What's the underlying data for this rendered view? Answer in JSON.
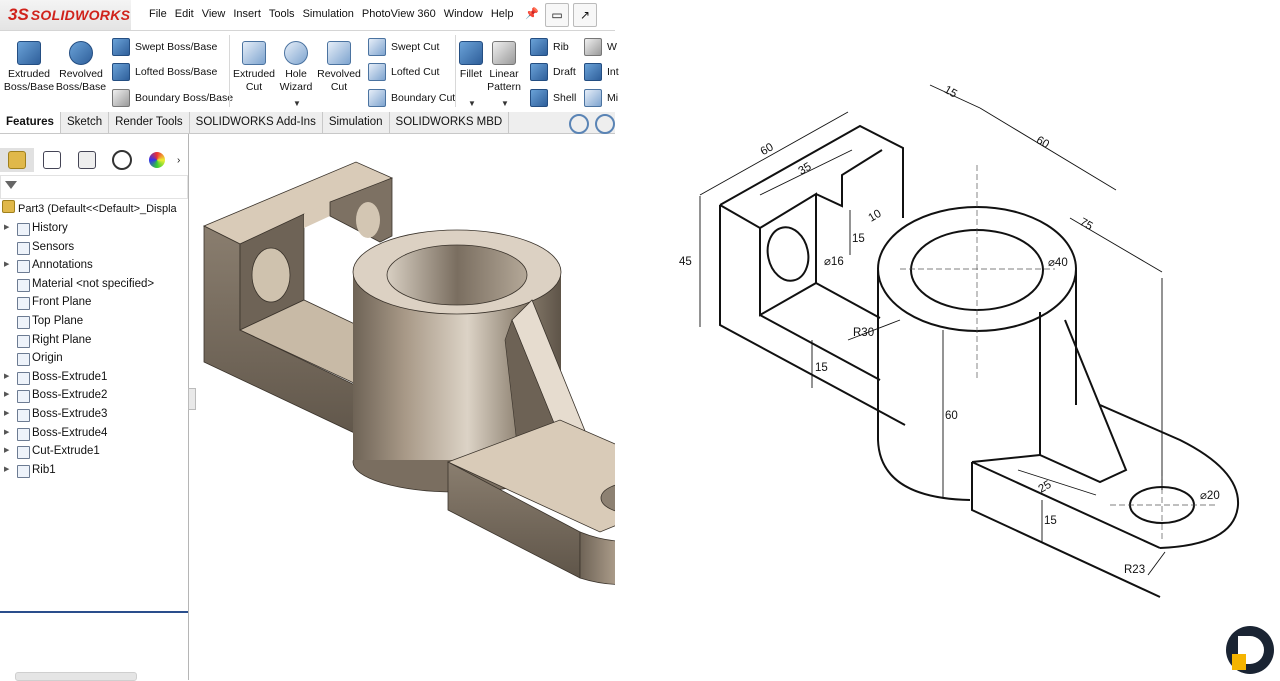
{
  "app": {
    "logo_prefix": "3S",
    "logo_name": "SOLIDWORKS",
    "menus": [
      "File",
      "Edit",
      "View",
      "Insert",
      "Tools",
      "Simulation",
      "PhotoView 360",
      "Window",
      "Help"
    ]
  },
  "ribbon": {
    "extruded_boss": "Extruded\nBoss/Base",
    "revolved_boss": "Revolved\nBoss/Base",
    "swept_boss": "Swept Boss/Base",
    "lofted_boss": "Lofted Boss/Base",
    "boundary_boss": "Boundary Boss/Base",
    "extruded_cut": "Extruded\nCut",
    "hole_wizard": "Hole\nWizard",
    "revolved_cut": "Revolved\nCut",
    "swept_cut": "Swept Cut",
    "lofted_cut": "Lofted Cut",
    "boundary_cut": "Boundary Cut",
    "fillet": "Fillet",
    "linear_pattern": "Linear\nPattern",
    "rib": "Rib",
    "draft": "Draft",
    "shell": "Shell",
    "wrap": "W",
    "intersect": "Int",
    "mirror": "Mi"
  },
  "tabs": [
    "Features",
    "Sketch",
    "Render Tools",
    "SOLIDWORKS Add-Ins",
    "Simulation",
    "SOLIDWORKS MBD"
  ],
  "tree": {
    "root": "Part3  (Default<<Default>_Displa",
    "items": [
      {
        "label": "History",
        "expandable": true
      },
      {
        "label": "Sensors",
        "expandable": false
      },
      {
        "label": "Annotations",
        "expandable": true
      },
      {
        "label": "Material <not specified>",
        "expandable": false
      },
      {
        "label": "Front Plane",
        "expandable": false
      },
      {
        "label": "Top Plane",
        "expandable": false
      },
      {
        "label": "Right Plane",
        "expandable": false
      },
      {
        "label": "Origin",
        "expandable": false
      },
      {
        "label": "Boss-Extrude1",
        "expandable": true
      },
      {
        "label": "Boss-Extrude2",
        "expandable": true
      },
      {
        "label": "Boss-Extrude3",
        "expandable": true
      },
      {
        "label": "Boss-Extrude4",
        "expandable": true
      },
      {
        "label": "Cut-Extrude1",
        "expandable": true
      },
      {
        "label": "Rib1",
        "expandable": true
      }
    ]
  },
  "drawing": {
    "dims": {
      "d15_top": "15",
      "d60_left": "60",
      "d60_right": "60",
      "d35": "35",
      "d10": "10",
      "d15_slot": "15",
      "d75": "75",
      "d45": "45",
      "d_dia16": "⌀16",
      "d_dia40": "⌀40",
      "r30": "R30",
      "d15_base": "15",
      "d60_height": "60",
      "d25": "25",
      "d_dia20": "⌀20",
      "d15_lower": "15",
      "r23": "R23"
    }
  },
  "colors": {
    "brand_red": "#d0221b",
    "model_light": "#d9cbb8",
    "model_dark": "#7a6c5c",
    "tree_accent": "#2a4e8c"
  }
}
